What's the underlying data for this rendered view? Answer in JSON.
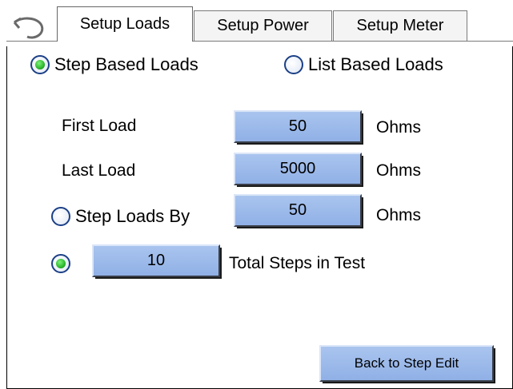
{
  "tabs": [
    {
      "label": "Setup Loads",
      "active": true
    },
    {
      "label": "Setup Power",
      "active": false
    },
    {
      "label": "Setup Meter",
      "active": false
    }
  ],
  "back_icon": "back-arrow-icon",
  "mode": {
    "step_based": {
      "label": "Step Based Loads",
      "selected": true
    },
    "list_based": {
      "label": "List Based Loads",
      "selected": false
    }
  },
  "first_load": {
    "label": "First Load",
    "value": "50",
    "unit": "Ohms"
  },
  "last_load": {
    "label": "Last Load",
    "value": "5000",
    "unit": "Ohms"
  },
  "step_loads_by": {
    "label": "Step Loads By",
    "value": "50",
    "unit": "Ohms",
    "selected": false
  },
  "total_steps": {
    "label": "Total Steps in Test",
    "value": "10",
    "selected": true
  },
  "back_button": {
    "label": "Back to Step Edit"
  },
  "colors": {
    "button_fill": "#a9c4ee",
    "radio_selected": "#2cb72c",
    "radio_border": "#1b3f86"
  }
}
